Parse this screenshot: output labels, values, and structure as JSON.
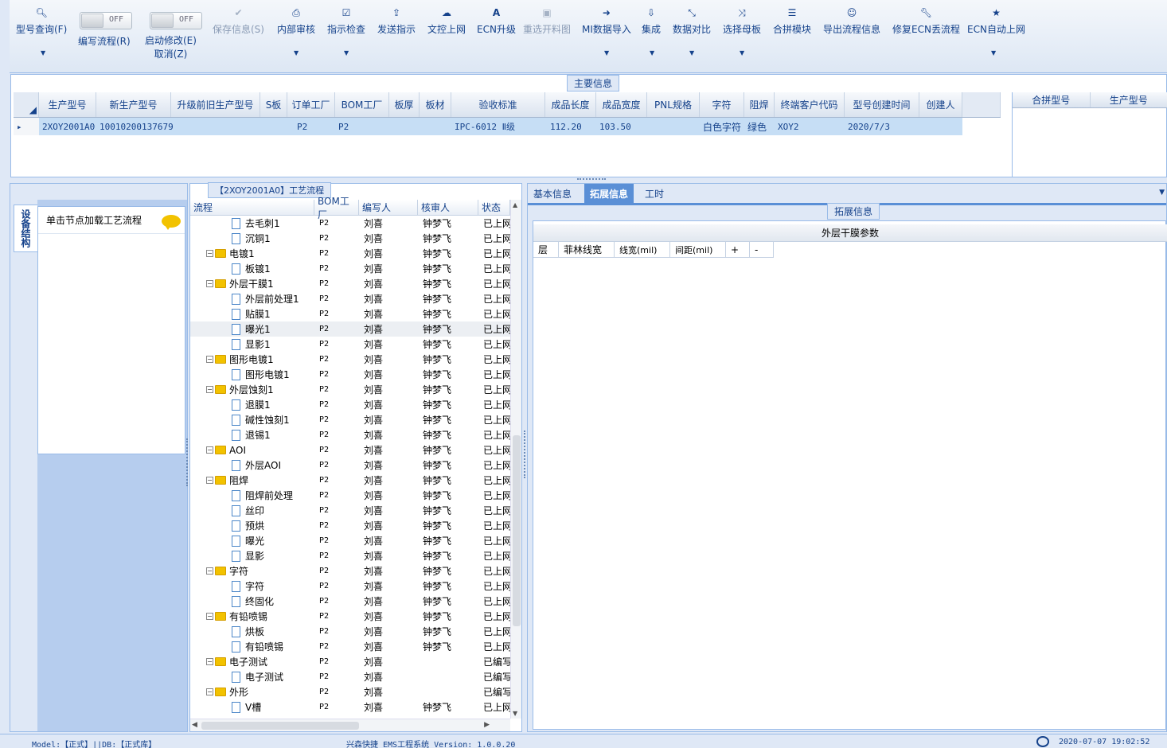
{
  "toolbar": {
    "buttons": [
      {
        "label": "型号查询(F)",
        "icon": "search-icon"
      },
      {
        "label": "编写流程(R)",
        "toggle": "OFF"
      },
      {
        "label": "启动修改(E)",
        "label2": "取消(Z)",
        "toggle": "OFF"
      },
      {
        "label": "保存信息(S)",
        "icon": "check-icon"
      },
      {
        "label": "内部审核",
        "icon": "printer-icon"
      },
      {
        "label": "指示检查",
        "icon": "checkbox-icon"
      },
      {
        "label": "发送指示",
        "icon": "upload-icon"
      },
      {
        "label": "文控上网",
        "icon": "cloud-upload-icon"
      },
      {
        "label": "ECN升级",
        "icon": "font-icon"
      },
      {
        "label": "重选开料图",
        "icon": "image-icon"
      },
      {
        "label": "MI数据导入",
        "icon": "sign-in-icon"
      },
      {
        "label": "集成",
        "icon": "download-icon"
      },
      {
        "label": "数据对比",
        "icon": "compress-icon"
      },
      {
        "label": "选择母板",
        "icon": "shuffle-icon"
      },
      {
        "label": "合拼模块",
        "icon": "list-icon"
      },
      {
        "label": "导出流程信息",
        "icon": "smile-icon"
      },
      {
        "label": "修复ECN丢流程",
        "icon": "wrench-icon"
      },
      {
        "label": "ECN自动上网",
        "icon": "star-icon"
      }
    ]
  },
  "main_info": {
    "title": "主要信息",
    "columns": [
      "生产型号",
      "新生产型号",
      "升级前旧生产型号",
      "S板",
      "订单工厂",
      "BOM工厂",
      "板厚",
      "板材",
      "验收标准",
      "成品长度",
      "成品宽度",
      "PNL规格",
      "字符",
      "阻焊",
      "终端客户代码",
      "型号创建时间",
      "创建人"
    ],
    "row": [
      "2XOY2001A0",
      "10010200137679",
      "",
      "",
      "P2",
      "P2",
      "",
      "",
      "IPC-6012 Ⅱ级",
      "112.20",
      "103.50",
      "",
      "白色字符",
      "绿色",
      "XOY2",
      "2020/7/3",
      ""
    ],
    "merge_columns": [
      "合拼型号",
      "生产型号"
    ]
  },
  "left_panel": {
    "tab": "设备结构",
    "hint": "单击节点加载工艺流程"
  },
  "process": {
    "title": "【2XOY2001A0】工艺流程",
    "columns": [
      "流程",
      "BOM工厂",
      "编写人",
      "核审人",
      "状态"
    ],
    "rows": [
      {
        "name": "去毛刺1",
        "level": 1,
        "bom": "P2",
        "writer": "刘喜",
        "reviewer": "钟梦飞",
        "status": "已上网"
      },
      {
        "name": "沉铜1",
        "level": 1,
        "bom": "P2",
        "writer": "刘喜",
        "reviewer": "钟梦飞",
        "status": "已上网"
      },
      {
        "name": "电镀1",
        "level": 0,
        "bom": "P2",
        "writer": "刘喜",
        "reviewer": "钟梦飞",
        "status": "已上网"
      },
      {
        "name": "板镀1",
        "level": 1,
        "bom": "P2",
        "writer": "刘喜",
        "reviewer": "钟梦飞",
        "status": "已上网"
      },
      {
        "name": "外层干膜1",
        "level": 0,
        "bom": "P2",
        "writer": "刘喜",
        "reviewer": "钟梦飞",
        "status": "已上网"
      },
      {
        "name": "外层前处理1",
        "level": 1,
        "bom": "P2",
        "writer": "刘喜",
        "reviewer": "钟梦飞",
        "status": "已上网"
      },
      {
        "name": "贴膜1",
        "level": 1,
        "bom": "P2",
        "writer": "刘喜",
        "reviewer": "钟梦飞",
        "status": "已上网"
      },
      {
        "name": "曝光1",
        "level": 1,
        "bom": "P2",
        "writer": "刘喜",
        "reviewer": "钟梦飞",
        "status": "已上网",
        "selected": true
      },
      {
        "name": "显影1",
        "level": 1,
        "bom": "P2",
        "writer": "刘喜",
        "reviewer": "钟梦飞",
        "status": "已上网"
      },
      {
        "name": "图形电镀1",
        "level": 0,
        "bom": "P2",
        "writer": "刘喜",
        "reviewer": "钟梦飞",
        "status": "已上网"
      },
      {
        "name": "图形电镀1",
        "level": 1,
        "bom": "P2",
        "writer": "刘喜",
        "reviewer": "钟梦飞",
        "status": "已上网"
      },
      {
        "name": "外层蚀刻1",
        "level": 0,
        "bom": "P2",
        "writer": "刘喜",
        "reviewer": "钟梦飞",
        "status": "已上网"
      },
      {
        "name": "退膜1",
        "level": 1,
        "bom": "P2",
        "writer": "刘喜",
        "reviewer": "钟梦飞",
        "status": "已上网"
      },
      {
        "name": "碱性蚀刻1",
        "level": 1,
        "bom": "P2",
        "writer": "刘喜",
        "reviewer": "钟梦飞",
        "status": "已上网"
      },
      {
        "name": "退锡1",
        "level": 1,
        "bom": "P2",
        "writer": "刘喜",
        "reviewer": "钟梦飞",
        "status": "已上网"
      },
      {
        "name": "AOI",
        "level": 0,
        "bom": "P2",
        "writer": "刘喜",
        "reviewer": "钟梦飞",
        "status": "已上网"
      },
      {
        "name": "外层AOI",
        "level": 1,
        "bom": "P2",
        "writer": "刘喜",
        "reviewer": "钟梦飞",
        "status": "已上网"
      },
      {
        "name": "阻焊",
        "level": 0,
        "bom": "P2",
        "writer": "刘喜",
        "reviewer": "钟梦飞",
        "status": "已上网"
      },
      {
        "name": "阻焊前处理",
        "level": 1,
        "bom": "P2",
        "writer": "刘喜",
        "reviewer": "钟梦飞",
        "status": "已上网"
      },
      {
        "name": "丝印",
        "level": 1,
        "bom": "P2",
        "writer": "刘喜",
        "reviewer": "钟梦飞",
        "status": "已上网"
      },
      {
        "name": "预烘",
        "level": 1,
        "bom": "P2",
        "writer": "刘喜",
        "reviewer": "钟梦飞",
        "status": "已上网"
      },
      {
        "name": "曝光",
        "level": 1,
        "bom": "P2",
        "writer": "刘喜",
        "reviewer": "钟梦飞",
        "status": "已上网"
      },
      {
        "name": "显影",
        "level": 1,
        "bom": "P2",
        "writer": "刘喜",
        "reviewer": "钟梦飞",
        "status": "已上网"
      },
      {
        "name": "字符",
        "level": 0,
        "bom": "P2",
        "writer": "刘喜",
        "reviewer": "钟梦飞",
        "status": "已上网"
      },
      {
        "name": "字符",
        "level": 1,
        "bom": "P2",
        "writer": "刘喜",
        "reviewer": "钟梦飞",
        "status": "已上网"
      },
      {
        "name": "终固化",
        "level": 1,
        "bom": "P2",
        "writer": "刘喜",
        "reviewer": "钟梦飞",
        "status": "已上网"
      },
      {
        "name": "有铅喷锡",
        "level": 0,
        "bom": "P2",
        "writer": "刘喜",
        "reviewer": "钟梦飞",
        "status": "已上网"
      },
      {
        "name": "烘板",
        "level": 1,
        "bom": "P2",
        "writer": "刘喜",
        "reviewer": "钟梦飞",
        "status": "已上网"
      },
      {
        "name": "有铅喷锡",
        "level": 1,
        "bom": "P2",
        "writer": "刘喜",
        "reviewer": "钟梦飞",
        "status": "已上网"
      },
      {
        "name": "电子测试",
        "level": 0,
        "bom": "P2",
        "writer": "刘喜",
        "reviewer": "",
        "status": "已编写"
      },
      {
        "name": "电子测试",
        "level": 1,
        "bom": "P2",
        "writer": "刘喜",
        "reviewer": "",
        "status": "已编写"
      },
      {
        "name": "外形",
        "level": 0,
        "bom": "P2",
        "writer": "刘喜",
        "reviewer": "",
        "status": "已编写"
      },
      {
        "name": "V槽",
        "level": 1,
        "bom": "P2",
        "writer": "刘喜",
        "reviewer": "钟梦飞",
        "status": "已上网"
      }
    ]
  },
  "right_tabs": [
    "基本信息",
    "拓展信息",
    "工时"
  ],
  "extension": {
    "title": "拓展信息",
    "section": "外层干膜参数",
    "columns": [
      "层",
      "菲林线宽",
      "线宽(mil)",
      "间距(mil)",
      "+",
      "-"
    ]
  },
  "status": {
    "left": "Model:【正式】||DB:【正式库】",
    "center": "兴森快捷 EMS工程系统 Version: 1.0.0.20",
    "right": "2020-07-07 19:02:52"
  }
}
